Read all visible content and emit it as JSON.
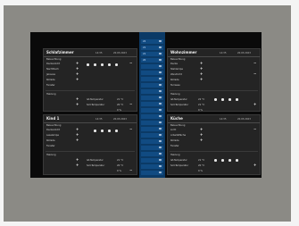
{
  "panels": [
    {
      "id": "schlafzimmer",
      "title": "Schlafzimmer",
      "meta": [
        "14:35",
        "20.03.2023"
      ],
      "sub": "Beleuchtung",
      "rows": [
        "Deckenlicht",
        "Nachttisch",
        "Jalousie",
        "Rollade",
        "Fenster"
      ],
      "rows2": [
        "Heizung",
        "Ist-Temperatur",
        "Soll-Temperatur"
      ],
      "vals": [
        "21 °C",
        "20 °C",
        "0 %"
      ]
    },
    {
      "id": "wohnzimmer",
      "title": "Wohnzimmer",
      "meta": [
        "14:35",
        "20.03.2023"
      ],
      "sub": "Beleuchtung",
      "rows": [
        "Decke",
        "Stehlampe",
        "Wandlicht",
        "Rollade",
        "Terrasse"
      ],
      "rows2": [
        "Heizung",
        "Ist-Temperatur",
        "Soll-Temperatur"
      ],
      "vals": [
        "22 °C",
        "21 °C",
        "0 %"
      ]
    },
    {
      "id": "kind1",
      "title": "Kind 1",
      "meta": [
        "14:35",
        "20.03.2023"
      ],
      "sub": "Beleuchtung",
      "rows": [
        "Deckenlicht",
        "Leselampe",
        "Rollade",
        "Fenster"
      ],
      "rows2": [
        "Heizung",
        "Ist-Temperatur",
        "Soll-Temperatur"
      ],
      "vals": [
        "21 °C",
        "20 °C",
        "0 %"
      ]
    },
    {
      "id": "kueche",
      "title": "Küche",
      "meta": [
        "14:35",
        "20.03.2023"
      ],
      "sub": "Beleuchtung",
      "rows": [
        "Licht",
        "Arbeitsfläche",
        "Rollade",
        "Fenster"
      ],
      "rows2": [
        "Heizung",
        "Ist-Temperatur",
        "Soll-Temperatur"
      ],
      "vals": [
        "21 °C",
        "20 °C",
        "0 %"
      ]
    }
  ],
  "center": {
    "values": [
      "22",
      "21",
      "21",
      "20",
      "",
      "",
      "",
      "",
      "",
      "",
      "",
      "",
      "",
      "",
      "",
      "",
      "",
      "",
      "",
      "",
      "",
      "",
      ""
    ]
  }
}
